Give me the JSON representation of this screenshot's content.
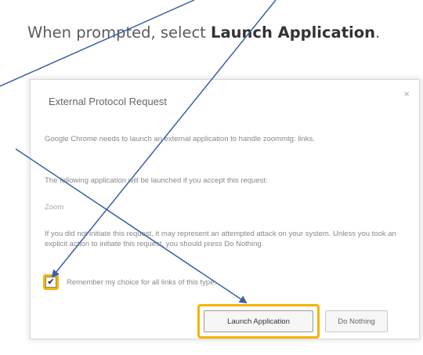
{
  "instruction": {
    "prefix": "When prompted, select ",
    "emphasis": "Launch Application",
    "suffix": "."
  },
  "dialog": {
    "title": "External Protocol Request",
    "close_icon": "×",
    "text1": "Google Chrome needs to launch an external application to handle zoommtg: links.",
    "text2": "The following application will be launched if you accept this request:",
    "app_name": "Zoom",
    "text3": "If you did not initiate this request, it may represent an attempted attack on your system. Unless you took an explicit action to initiate this request, you should press Do Nothing.",
    "remember_label": "Remember my choice for all links of this type.",
    "remember_checked": "✔",
    "launch_label": "Launch Application",
    "nothing_label": "Do Nothing"
  },
  "colors": {
    "highlight": "#f4b400",
    "arrow": "#3a5fa8"
  }
}
